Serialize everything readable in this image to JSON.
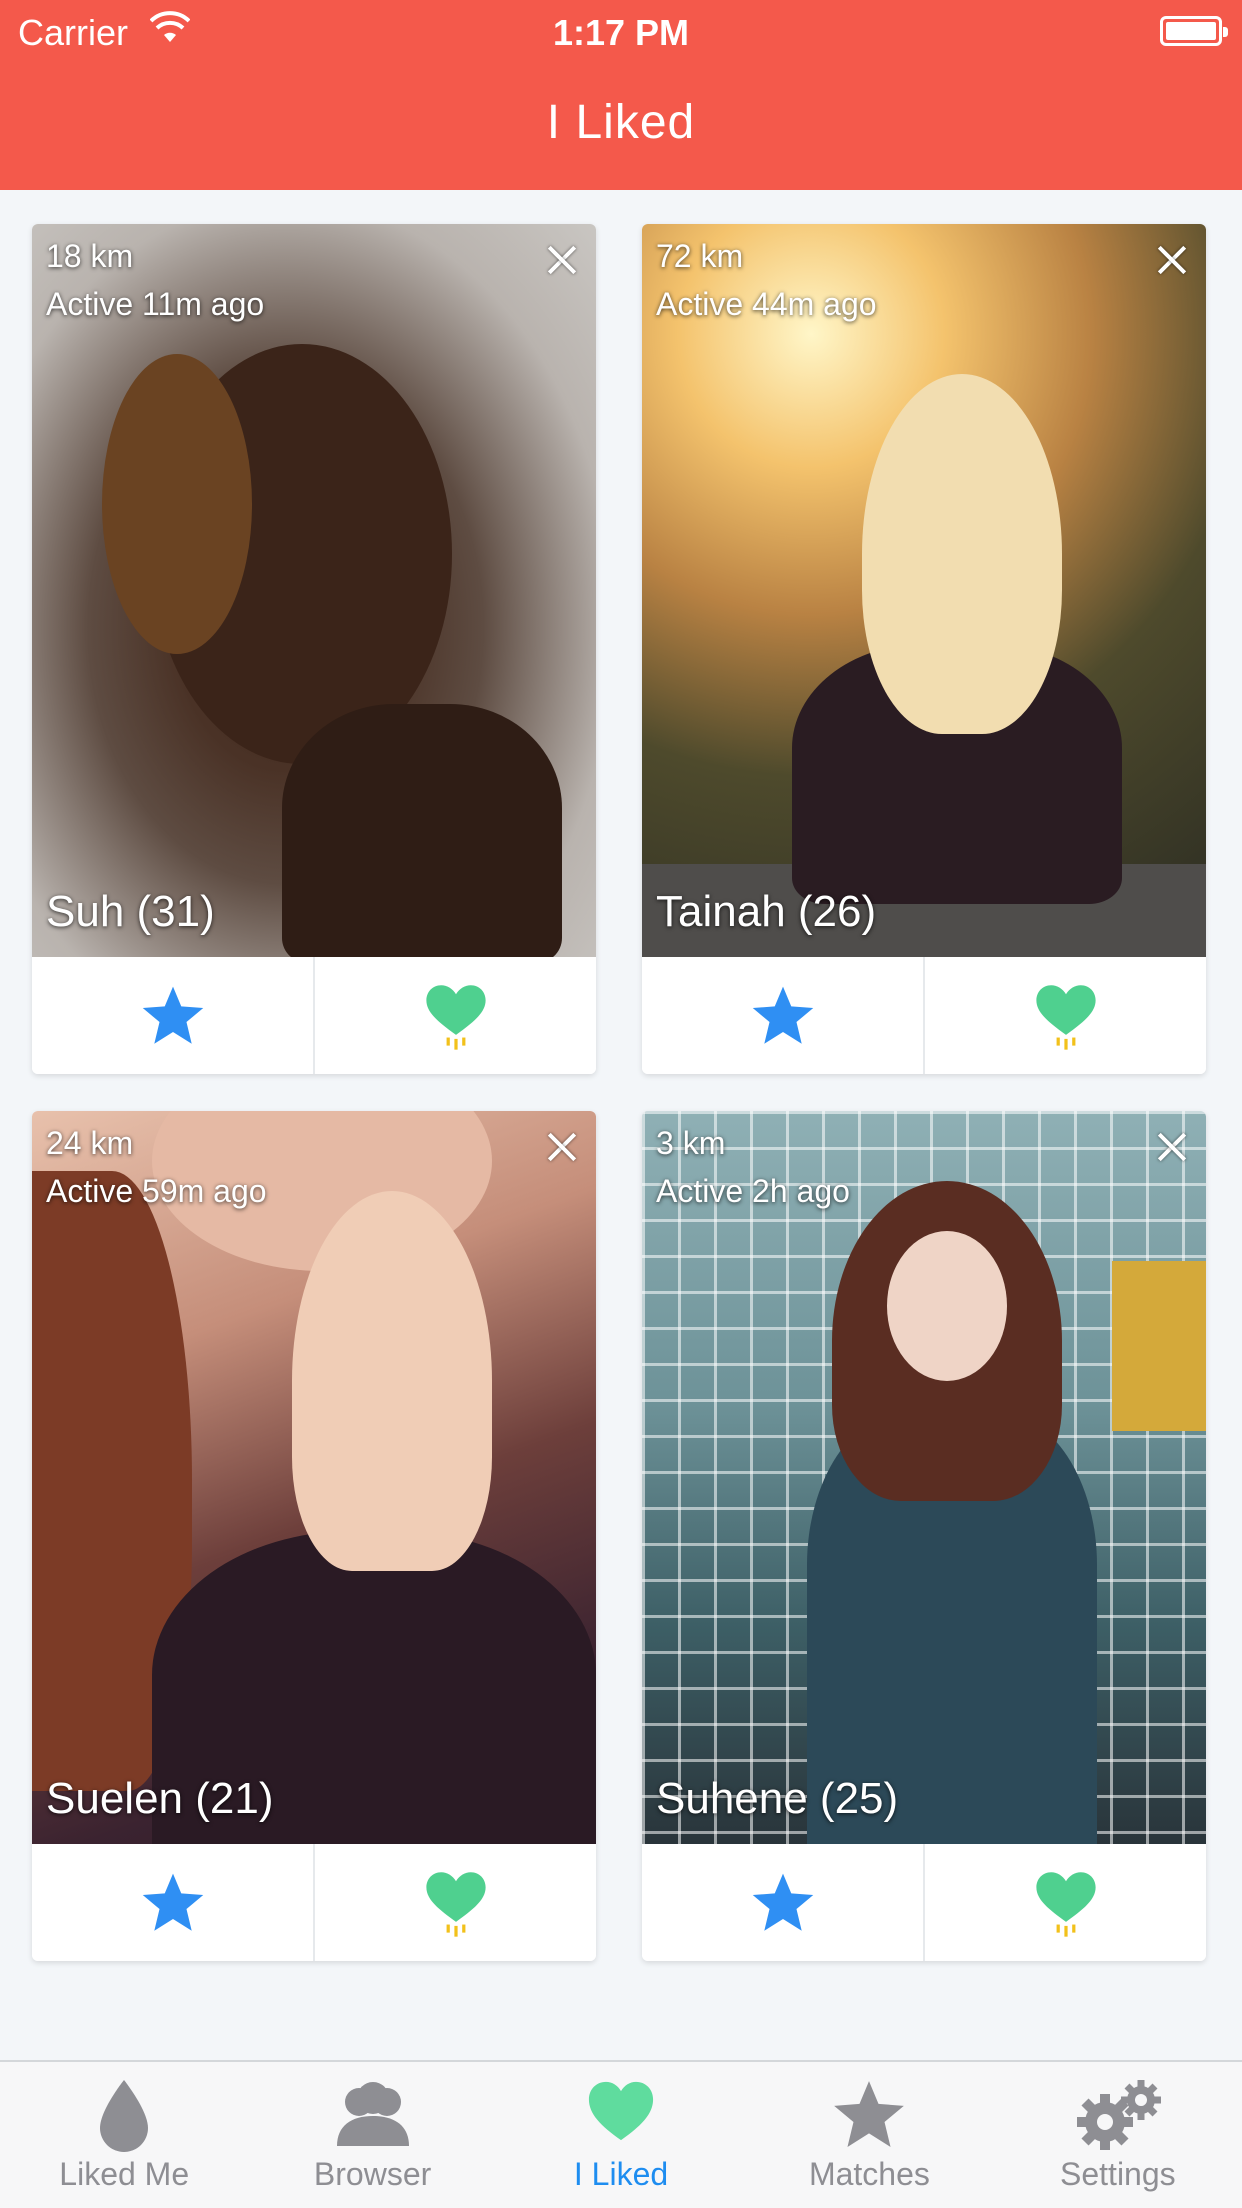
{
  "status_bar": {
    "carrier": "Carrier",
    "time": "1:17 PM"
  },
  "nav": {
    "title": "I Liked"
  },
  "colors": {
    "nav_background": "#f4594b",
    "star": "#2f8ff3",
    "heart": "#4fd08f",
    "active_tab": "#1e8df0",
    "inactive_tab": "#8e8e93"
  },
  "cards": [
    {
      "distance": "18 km",
      "active": "Active 11m ago",
      "name": "Suh (31)"
    },
    {
      "distance": "72 km",
      "active": "Active 44m ago",
      "name": "Tainah (26)"
    },
    {
      "distance": "24 km",
      "active": "Active 59m ago",
      "name": "Suelen (21)"
    },
    {
      "distance": "3 km",
      "active": "Active 2h ago",
      "name": "Suhene (25)"
    }
  ],
  "tabs": [
    {
      "label": "Liked Me",
      "icon": "drop-icon"
    },
    {
      "label": "Browser",
      "icon": "people-icon"
    },
    {
      "label": "I Liked",
      "icon": "heart-icon",
      "selected": true
    },
    {
      "label": "Matches",
      "icon": "star-icon"
    },
    {
      "label": "Settings",
      "icon": "gears-icon"
    }
  ]
}
